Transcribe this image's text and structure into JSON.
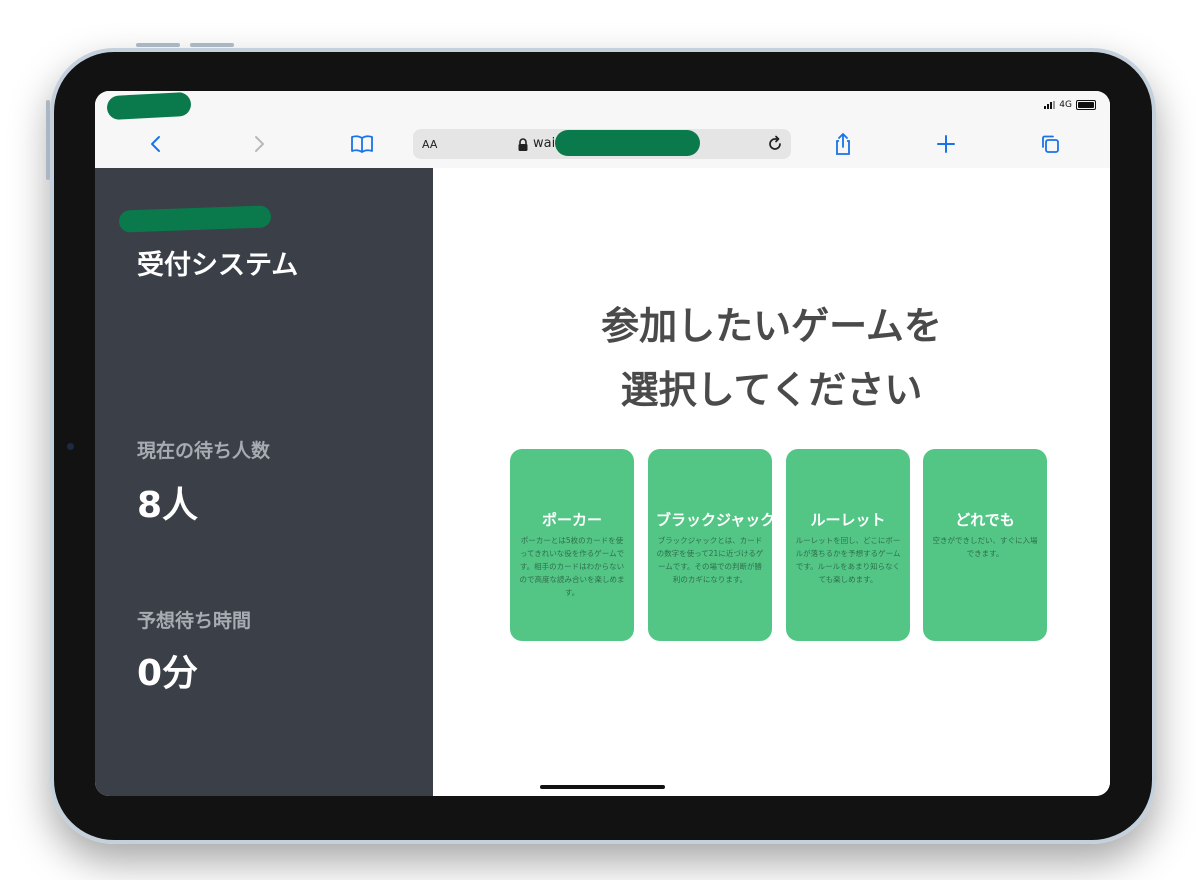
{
  "status_bar": {
    "network": "4G"
  },
  "browser": {
    "reader_label": "AA",
    "url": "wait",
    "icons": {
      "back": "chevron-left-icon",
      "forward": "chevron-right-icon",
      "bookmarks": "book-icon",
      "lock": "lock-icon",
      "reload": "reload-icon",
      "share": "share-icon",
      "new_tab": "plus-icon",
      "tabs": "tabs-icon"
    },
    "accent": "#1a73e8"
  },
  "sidebar": {
    "title": "受付システム",
    "waiting_label": "現在の待ち人数",
    "waiting_value": "8人",
    "wait_time_label": "予想待ち時間",
    "wait_time_value": "0分"
  },
  "main": {
    "heading_line1": "参加したいゲームを",
    "heading_line2": "選択してください",
    "cards": [
      {
        "title": "ポーカー",
        "description": "ポーカーとは5枚のカードを使ってきれいな役を作るゲームです。相手のカードはわからないので高度な読み合いを楽しめます。"
      },
      {
        "title": "ブラックジャック",
        "description": "ブラックジャックとは、カードの数字を使って21に近づけるゲームです。その場での判断が勝利のカギになります。"
      },
      {
        "title": "ルーレット",
        "description": "ルーレットを回し、どこにボールが落ちるかを予想するゲームです。ルールをあまり知らなくても楽しめます。"
      },
      {
        "title": "どれでも",
        "description": "空きができしだい、すぐに入場できます。"
      }
    ]
  },
  "colors": {
    "sidebar_bg": "#3b3f47",
    "card_bg": "#53c686",
    "redaction": "#0a7a4c"
  }
}
